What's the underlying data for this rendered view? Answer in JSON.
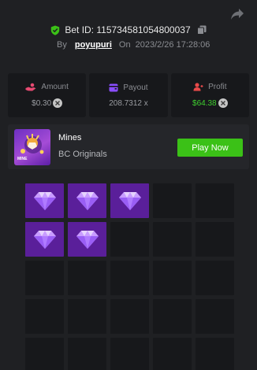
{
  "header": {
    "bet_id_label": "Bet ID: 115734581054800037",
    "by_label": "By",
    "username": "poyupuri",
    "on_label": "On",
    "datetime": "2023/2/26 17:28:06",
    "icons": [
      "share-icon",
      "shield-check-icon",
      "copy-icon"
    ]
  },
  "stats": [
    {
      "label": "Amount",
      "value": "$0.30",
      "icon": "hand-coins-icon",
      "icon_color": "#e84a72"
    },
    {
      "label": "Payout",
      "value": "208.7312 x",
      "icon": "wallet-icon",
      "icon_color": "#8a4dff"
    },
    {
      "label": "Profit",
      "value": "$64.38",
      "icon": "person-profit-icon",
      "icon_color": "#e84a4a",
      "value_color": "#3fcf2f"
    }
  ],
  "game": {
    "title": "Mines",
    "provider": "BC Originals",
    "thumb_label": "MINE",
    "play_button": "Play Now",
    "button_color": "#3bc117"
  },
  "board": {
    "columns": 5,
    "revealed_icon": "gem-icon",
    "tiles": [
      "gem",
      "gem",
      "gem",
      "hidden",
      "hidden",
      "gem",
      "gem",
      "hidden",
      "hidden",
      "hidden",
      "hidden",
      "hidden",
      "hidden",
      "hidden",
      "hidden",
      "hidden",
      "hidden",
      "hidden",
      "hidden",
      "hidden",
      "hidden",
      "hidden",
      "hidden",
      "hidden",
      "hidden"
    ]
  }
}
